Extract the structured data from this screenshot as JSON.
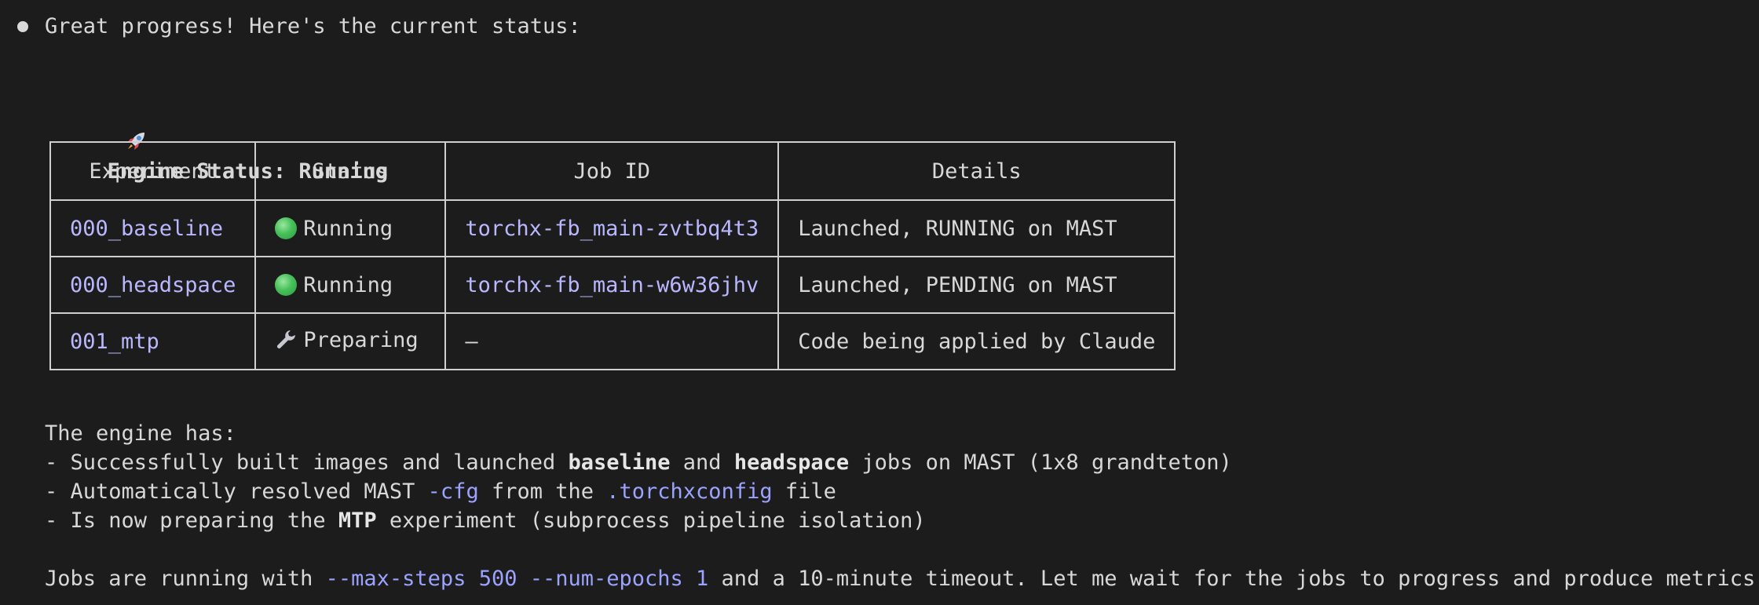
{
  "message": {
    "intro": "Great progress! Here's the current status:",
    "heading": {
      "icon": "rocket-icon",
      "text": "Engine Status: Running"
    }
  },
  "table": {
    "headers": [
      "Experiment",
      "Status",
      "Job ID",
      "Details"
    ],
    "rows": [
      {
        "experiment": "000_baseline",
        "status_icon": "green-circle-icon",
        "status": "Running",
        "job_id": "torchx-fb_main-zvtbq4t3",
        "details": "Launched, RUNNING on MAST"
      },
      {
        "experiment": "000_headspace",
        "status_icon": "green-circle-icon",
        "status": "Running",
        "job_id": "torchx-fb_main-w6w36jhv",
        "details": "Launched, PENDING on MAST"
      },
      {
        "experiment": "001_mtp",
        "status_icon": "wrench-icon",
        "status": "Preparing",
        "job_id": "—",
        "details": "Code being applied by Claude"
      }
    ]
  },
  "summary": {
    "intro": "The engine has:",
    "line1": {
      "a": "- Successfully built images and launched ",
      "b1": "baseline",
      "c": " and ",
      "b2": "headspace",
      "d": " jobs on MAST (1x8 grandteton)"
    },
    "line2": {
      "a": "- Automatically resolved MAST ",
      "code1": "-cfg",
      "b": " from the ",
      "code2": ".torchxconfig",
      "c": " file"
    },
    "line3": {
      "a": "- Is now preparing the ",
      "b1": "MTP",
      "c": " experiment (subprocess pipeline isolation)"
    },
    "closing": {
      "a": "Jobs are running with ",
      "code1": "--max-steps 500 --num-epochs 1",
      "b": " and a 10-minute timeout. Let me wait for the jobs to progress and produce metrics."
    }
  },
  "colors": {
    "background": "#1c1c1c",
    "text": "#d8d8d8",
    "link": "#b9b8ff",
    "code": "#9ba3ff",
    "running": "#47c05a"
  }
}
